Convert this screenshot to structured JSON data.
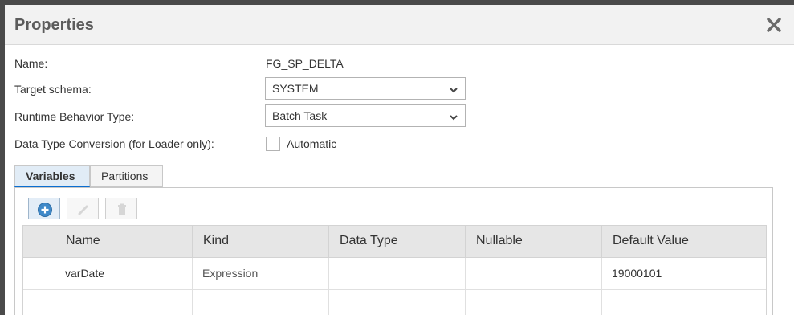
{
  "dialog": {
    "title": "Properties",
    "close_icon": "close-icon"
  },
  "form": {
    "name_label": "Name:",
    "name_value": "FG_SP_DELTA",
    "schema_label": "Target schema:",
    "schema_value": "SYSTEM",
    "runtime_label": "Runtime Behavior Type:",
    "runtime_value": "Batch Task",
    "conversion_label": "Data Type Conversion (for Loader only):",
    "conversion_option": "Automatic",
    "conversion_checked": false
  },
  "tabs": [
    {
      "label": "Variables",
      "active": true
    },
    {
      "label": "Partitions",
      "active": false
    }
  ],
  "toolbar": {
    "add_icon": "add-circle-icon",
    "edit_icon": "pencil-icon",
    "delete_icon": "trash-icon"
  },
  "table": {
    "columns": [
      "Name",
      "Kind",
      "Data Type",
      "Nullable",
      "Default Value"
    ],
    "rows": [
      [
        "varDate",
        "Expression",
        "",
        "",
        "19000101"
      ],
      [
        "",
        "",
        "",
        "",
        ""
      ]
    ]
  },
  "colors": {
    "accent": "#0a6ed1",
    "header_bg": "#f2f2f2",
    "grid_header_bg": "#e6e6e6"
  }
}
